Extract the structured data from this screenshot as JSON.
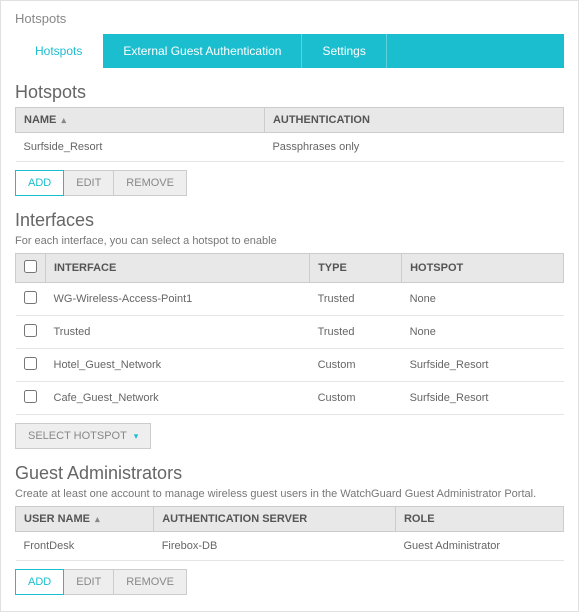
{
  "page_title": "Hotspots",
  "tabs": [
    {
      "label": "Hotspots",
      "active": true
    },
    {
      "label": "External Guest Authentication",
      "active": false
    },
    {
      "label": "Settings",
      "active": false
    }
  ],
  "hotspots_section": {
    "title": "Hotspots",
    "columns": {
      "name": "NAME",
      "auth": "AUTHENTICATION"
    },
    "rows": [
      {
        "name": "Surfside_Resort",
        "auth": "Passphrases only"
      }
    ],
    "buttons": {
      "add": "ADD",
      "edit": "EDIT",
      "remove": "REMOVE"
    }
  },
  "interfaces_section": {
    "title": "Interfaces",
    "desc": "For each interface, you can select a hotspot to enable",
    "columns": {
      "interface": "INTERFACE",
      "type": "TYPE",
      "hotspot": "HOTSPOT"
    },
    "rows": [
      {
        "iface": "WG-Wireless-Access-Point1",
        "type": "Trusted",
        "hotspot": "None"
      },
      {
        "iface": "Trusted",
        "type": "Trusted",
        "hotspot": "None"
      },
      {
        "iface": "Hotel_Guest_Network",
        "type": "Custom",
        "hotspot": "Surfside_Resort"
      },
      {
        "iface": "Cafe_Guest_Network",
        "type": "Custom",
        "hotspot": "Surfside_Resort"
      }
    ],
    "select_hotspot": "SELECT HOTSPOT"
  },
  "admins_section": {
    "title": "Guest Administrators",
    "desc": "Create at least one account to manage wireless guest users in the WatchGuard Guest Administrator Portal.",
    "columns": {
      "user": "USER NAME",
      "authserver": "AUTHENTICATION SERVER",
      "role": "ROLE"
    },
    "rows": [
      {
        "user": "FrontDesk",
        "authserver": "Firebox-DB",
        "role": "Guest Administrator"
      }
    ],
    "buttons": {
      "add": "ADD",
      "edit": "EDIT",
      "remove": "REMOVE"
    }
  }
}
